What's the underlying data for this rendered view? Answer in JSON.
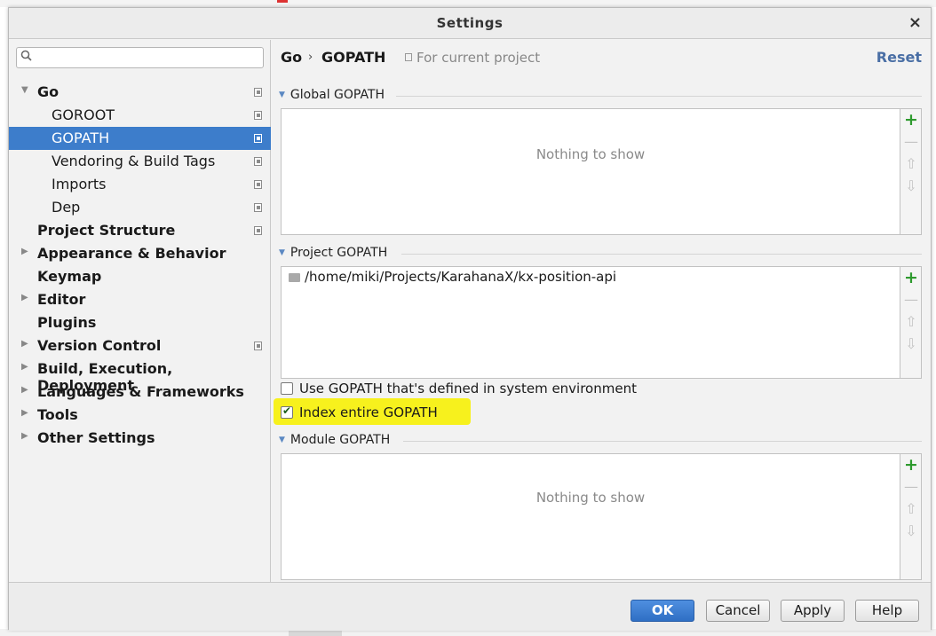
{
  "dialog": {
    "title": "Settings",
    "close_label": "×"
  },
  "search": {
    "placeholder": "",
    "icon": "magnifier-icon"
  },
  "sidebar": {
    "items": [
      {
        "label": "Go",
        "expanded": true,
        "has_icon": true
      },
      {
        "label": "GOROOT",
        "has_icon": true
      },
      {
        "label": "GOPATH",
        "selected": true,
        "has_icon": true
      },
      {
        "label": "Vendoring & Build Tags",
        "has_icon": true
      },
      {
        "label": "Imports",
        "has_icon": true
      },
      {
        "label": "Dep",
        "has_icon": true
      },
      {
        "label": "Project Structure",
        "has_icon": true
      },
      {
        "label": "Appearance & Behavior",
        "collapsed": true
      },
      {
        "label": "Keymap"
      },
      {
        "label": "Editor",
        "collapsed": true
      },
      {
        "label": "Plugins"
      },
      {
        "label": "Version Control",
        "collapsed": true,
        "has_icon": true
      },
      {
        "label": "Build, Execution, Deployment",
        "collapsed": true
      },
      {
        "label": "Languages & Frameworks",
        "collapsed": true
      },
      {
        "label": "Tools",
        "collapsed": true
      },
      {
        "label": "Other Settings",
        "collapsed": true
      }
    ]
  },
  "header": {
    "breadcrumb_root": "Go",
    "breadcrumb_sep": "›",
    "breadcrumb_current": "GOPATH",
    "scope_text": "For current project",
    "reset_label": "Reset"
  },
  "global_gopath": {
    "title": "Global GOPATH",
    "empty_text": "Nothing to show"
  },
  "project_gopath": {
    "title": "Project GOPATH",
    "paths": [
      "/home/miki/Projects/KarahanaX/kx-position-api"
    ]
  },
  "options": {
    "use_system_env": {
      "label": "Use GOPATH that's defined in system environment",
      "checked": false
    },
    "index_entire": {
      "label": "Index entire GOPATH",
      "checked": true
    }
  },
  "module_gopath": {
    "title": "Module GOPATH",
    "empty_text": "Nothing to show"
  },
  "toolbar": {
    "add": "+",
    "remove": "—",
    "up": "⇧",
    "down": "⇩"
  },
  "footer": {
    "ok_label": "OK",
    "cancel_label": "Cancel",
    "apply_label": "Apply",
    "help_label": "Help"
  },
  "colors": {
    "selection": "#3d7dcb",
    "highlight": "#f7f11d",
    "add_green": "#2e9a2e",
    "link": "#4a6fa5"
  }
}
